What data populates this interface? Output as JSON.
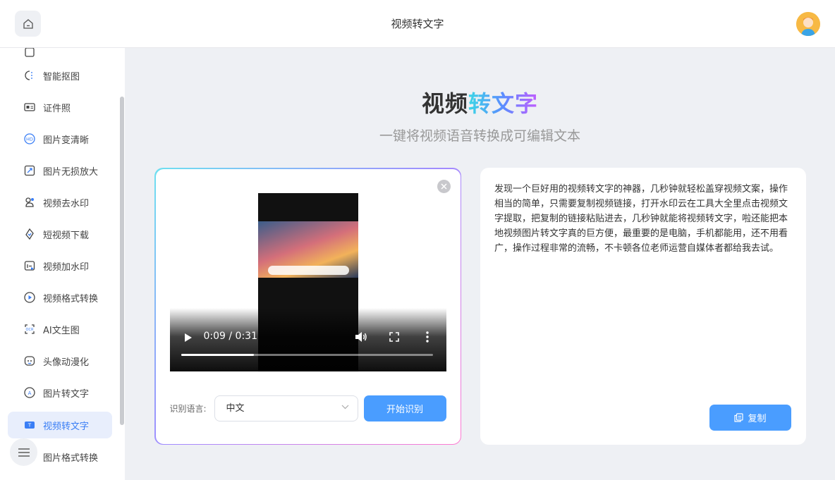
{
  "header": {
    "title": "视频转文字"
  },
  "sidebar": {
    "items": [
      {
        "label": "",
        "icon": "partial-icon"
      },
      {
        "label": "智能抠图",
        "icon": "cutout-icon"
      },
      {
        "label": "证件照",
        "icon": "id-photo-icon"
      },
      {
        "label": "图片变清晰",
        "icon": "hd-icon"
      },
      {
        "label": "图片无损放大",
        "icon": "enlarge-icon"
      },
      {
        "label": "视频去水印",
        "icon": "remove-watermark-icon"
      },
      {
        "label": "短视频下载",
        "icon": "download-icon"
      },
      {
        "label": "视频加水印",
        "icon": "add-watermark-icon"
      },
      {
        "label": "视频格式转换",
        "icon": "format-convert-icon"
      },
      {
        "label": "AI文生图",
        "icon": "ai-image-icon"
      },
      {
        "label": "头像动漫化",
        "icon": "anime-avatar-icon"
      },
      {
        "label": "图片转文字",
        "icon": "image-to-text-icon"
      },
      {
        "label": "视频转文字",
        "icon": "video-to-text-icon",
        "active": true
      },
      {
        "label": "图片格式转换",
        "icon": "image-format-icon"
      }
    ]
  },
  "main": {
    "title_part1": "视频",
    "title_part2": "转文字",
    "subtitle": "一键将视频语音转换成可编辑文本"
  },
  "player": {
    "time": "0:09 / 0:31",
    "progress": 0.29
  },
  "language": {
    "label": "识别语言:",
    "selected": "中文"
  },
  "actions": {
    "start_label": "开始识别",
    "copy_label": "复制"
  },
  "result": {
    "text": "发现一个巨好用的视频转文字的神器，几秒钟就轻松盖穿视频文案，操作相当的简单，只需要复制视频链接，打开水印云在工具大全里点击视频文字提取，把复制的链接粘贴进去，几秒钟就能将视频转文字，啦还能把本地视频图片转文字真的巨方便，最重要的是电脑，手机都能用，还不用看广，操作过程非常的流畅，不卡顿各位老师运营自媒体者都给我去试。"
  },
  "colors": {
    "accent": "#4a9dff",
    "active_bg": "#e8eefc",
    "active_text": "#3a7ef5"
  }
}
